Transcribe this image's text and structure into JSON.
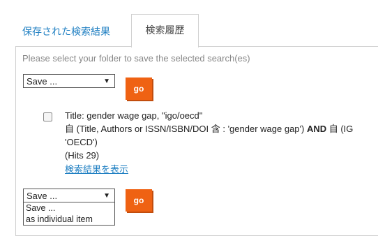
{
  "tabs": {
    "saved_label": "保存された検索結果",
    "history_label": "検索履歴"
  },
  "hint": "Please select your folder to save the selected search(es)",
  "top_select": {
    "value": "Save ..."
  },
  "go_label": "go",
  "search_item": {
    "title": "Title: gender wage gap, \"igo/oecd\"",
    "query_line1_pre": "自 (Title, Authors or ISSN/ISBN/DOI 含 :  'gender wage gap') ",
    "query_and": "AND",
    "query_line1_post": " 自 (IG",
    "query_line2": "'OECD')",
    "hits": "(Hits 29)",
    "show_results_link": "検索結果を表示"
  },
  "bottom_select": {
    "value": "Save ...",
    "options": [
      "Save ...",
      "as individual item"
    ]
  },
  "icons": {
    "dropdown_arrow": "▼"
  }
}
